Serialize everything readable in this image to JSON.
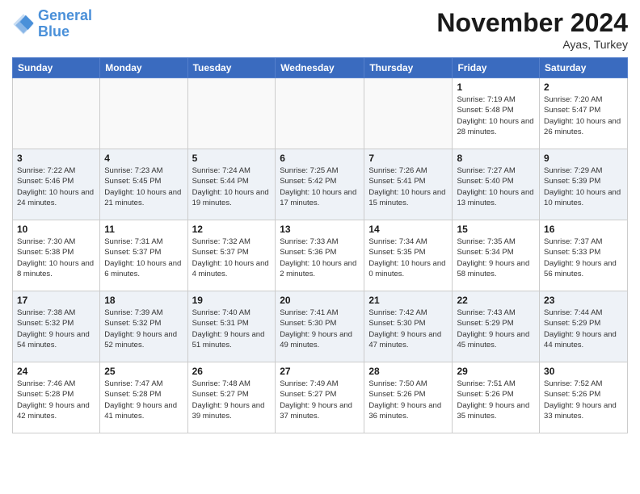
{
  "header": {
    "logo_line1": "General",
    "logo_line2": "Blue",
    "month": "November 2024",
    "location": "Ayas, Turkey"
  },
  "weekdays": [
    "Sunday",
    "Monday",
    "Tuesday",
    "Wednesday",
    "Thursday",
    "Friday",
    "Saturday"
  ],
  "weeks": [
    [
      {
        "day": "",
        "info": ""
      },
      {
        "day": "",
        "info": ""
      },
      {
        "day": "",
        "info": ""
      },
      {
        "day": "",
        "info": ""
      },
      {
        "day": "",
        "info": ""
      },
      {
        "day": "1",
        "info": "Sunrise: 7:19 AM\nSunset: 5:48 PM\nDaylight: 10 hours and 28 minutes."
      },
      {
        "day": "2",
        "info": "Sunrise: 7:20 AM\nSunset: 5:47 PM\nDaylight: 10 hours and 26 minutes."
      }
    ],
    [
      {
        "day": "3",
        "info": "Sunrise: 7:22 AM\nSunset: 5:46 PM\nDaylight: 10 hours and 24 minutes."
      },
      {
        "day": "4",
        "info": "Sunrise: 7:23 AM\nSunset: 5:45 PM\nDaylight: 10 hours and 21 minutes."
      },
      {
        "day": "5",
        "info": "Sunrise: 7:24 AM\nSunset: 5:44 PM\nDaylight: 10 hours and 19 minutes."
      },
      {
        "day": "6",
        "info": "Sunrise: 7:25 AM\nSunset: 5:42 PM\nDaylight: 10 hours and 17 minutes."
      },
      {
        "day": "7",
        "info": "Sunrise: 7:26 AM\nSunset: 5:41 PM\nDaylight: 10 hours and 15 minutes."
      },
      {
        "day": "8",
        "info": "Sunrise: 7:27 AM\nSunset: 5:40 PM\nDaylight: 10 hours and 13 minutes."
      },
      {
        "day": "9",
        "info": "Sunrise: 7:29 AM\nSunset: 5:39 PM\nDaylight: 10 hours and 10 minutes."
      }
    ],
    [
      {
        "day": "10",
        "info": "Sunrise: 7:30 AM\nSunset: 5:38 PM\nDaylight: 10 hours and 8 minutes."
      },
      {
        "day": "11",
        "info": "Sunrise: 7:31 AM\nSunset: 5:37 PM\nDaylight: 10 hours and 6 minutes."
      },
      {
        "day": "12",
        "info": "Sunrise: 7:32 AM\nSunset: 5:37 PM\nDaylight: 10 hours and 4 minutes."
      },
      {
        "day": "13",
        "info": "Sunrise: 7:33 AM\nSunset: 5:36 PM\nDaylight: 10 hours and 2 minutes."
      },
      {
        "day": "14",
        "info": "Sunrise: 7:34 AM\nSunset: 5:35 PM\nDaylight: 10 hours and 0 minutes."
      },
      {
        "day": "15",
        "info": "Sunrise: 7:35 AM\nSunset: 5:34 PM\nDaylight: 9 hours and 58 minutes."
      },
      {
        "day": "16",
        "info": "Sunrise: 7:37 AM\nSunset: 5:33 PM\nDaylight: 9 hours and 56 minutes."
      }
    ],
    [
      {
        "day": "17",
        "info": "Sunrise: 7:38 AM\nSunset: 5:32 PM\nDaylight: 9 hours and 54 minutes."
      },
      {
        "day": "18",
        "info": "Sunrise: 7:39 AM\nSunset: 5:32 PM\nDaylight: 9 hours and 52 minutes."
      },
      {
        "day": "19",
        "info": "Sunrise: 7:40 AM\nSunset: 5:31 PM\nDaylight: 9 hours and 51 minutes."
      },
      {
        "day": "20",
        "info": "Sunrise: 7:41 AM\nSunset: 5:30 PM\nDaylight: 9 hours and 49 minutes."
      },
      {
        "day": "21",
        "info": "Sunrise: 7:42 AM\nSunset: 5:30 PM\nDaylight: 9 hours and 47 minutes."
      },
      {
        "day": "22",
        "info": "Sunrise: 7:43 AM\nSunset: 5:29 PM\nDaylight: 9 hours and 45 minutes."
      },
      {
        "day": "23",
        "info": "Sunrise: 7:44 AM\nSunset: 5:29 PM\nDaylight: 9 hours and 44 minutes."
      }
    ],
    [
      {
        "day": "24",
        "info": "Sunrise: 7:46 AM\nSunset: 5:28 PM\nDaylight: 9 hours and 42 minutes."
      },
      {
        "day": "25",
        "info": "Sunrise: 7:47 AM\nSunset: 5:28 PM\nDaylight: 9 hours and 41 minutes."
      },
      {
        "day": "26",
        "info": "Sunrise: 7:48 AM\nSunset: 5:27 PM\nDaylight: 9 hours and 39 minutes."
      },
      {
        "day": "27",
        "info": "Sunrise: 7:49 AM\nSunset: 5:27 PM\nDaylight: 9 hours and 37 minutes."
      },
      {
        "day": "28",
        "info": "Sunrise: 7:50 AM\nSunset: 5:26 PM\nDaylight: 9 hours and 36 minutes."
      },
      {
        "day": "29",
        "info": "Sunrise: 7:51 AM\nSunset: 5:26 PM\nDaylight: 9 hours and 35 minutes."
      },
      {
        "day": "30",
        "info": "Sunrise: 7:52 AM\nSunset: 5:26 PM\nDaylight: 9 hours and 33 minutes."
      }
    ]
  ]
}
